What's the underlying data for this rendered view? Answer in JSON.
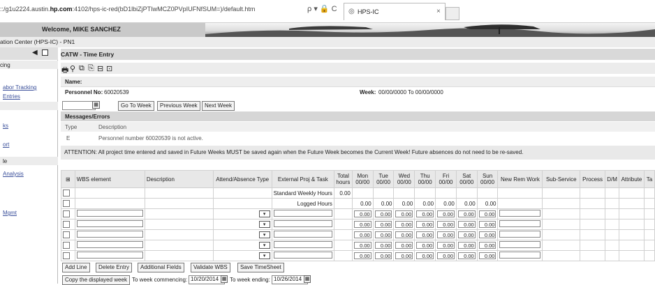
{
  "browser": {
    "url_prefix": "::/g1u2224.austin.",
    "url_host": "hp.com",
    "url_rest": ":4102/hps-ic-red(bD1lbiZjPTIwMCZ0PVpIUFNfSUM=)/default.htm",
    "url_icons": "ρ ▾ 🔒 C",
    "tab_title": "HPS-IC",
    "tab_close": "×"
  },
  "header": {
    "welcome": "Welcome, MIKE SANCHEZ",
    "org_title": "ation Center (HPS-IC) - PN1"
  },
  "nav": {
    "items": [
      {
        "label": "cing",
        "link": false
      },
      {
        "label": "abor Tracking",
        "link": true
      },
      {
        "label": "Entries",
        "link": true
      },
      {
        "label": "ks",
        "link": true
      },
      {
        "label": "ort",
        "link": true
      },
      {
        "label": "le",
        "link": false
      },
      {
        "label": "Analysis",
        "link": true
      },
      {
        "label": "Mgmt",
        "link": true
      }
    ]
  },
  "page": {
    "title": "CATW - Time Entry",
    "name_label": "Name:",
    "personnel_label": "Personnel No:",
    "personnel_value": "60020539",
    "week_label": "Week:",
    "week_value": "00/00/0000 To 00/00/0000",
    "goto_week": "Go To Week",
    "prev_week": "Previous Week",
    "next_week": "Next Week"
  },
  "messages": {
    "title": "Messages/Errors",
    "col_type": "Type",
    "col_desc": "Description",
    "rows": [
      {
        "type": "E",
        "desc": "Personnel number 60020539 is not active."
      }
    ]
  },
  "attention": "ATTENTION: All project time entered and saved in Future Weeks MUST be saved again when the Future Week becomes the Current Week! Future absences do not need to be re-saved.",
  "grid": {
    "headers": {
      "wbs": "WBS element",
      "description": "Description",
      "attend": "Attend/Absence Type",
      "ext": "External Proj & Task",
      "total": "Total hours",
      "mon": "Mon 00/00",
      "tue": "Tue 00/00",
      "wed": "Wed 00/00",
      "thu": "Thu 00/00",
      "fri": "Fri 00/00",
      "sat": "Sat 00/00",
      "sun": "Sun 00/00",
      "rem": "New Rem Work",
      "sub": "Sub-Service",
      "process": "Process",
      "dm": "D/M",
      "attribute": "Attribute",
      "ta": "Ta"
    },
    "standard_label": "Standard Weekly Hours",
    "standard_total": "0.00",
    "logged_label": "Logged Hours",
    "logged_values": [
      "0.00",
      "0.00",
      "0.00",
      "0.00",
      "0.00",
      "0.00",
      "0.00"
    ],
    "entry_value": "0.00",
    "dropdown_glyph": "▾"
  },
  "actions": {
    "add_line": "Add Line",
    "delete_entry": "Delete Entry",
    "additional_fields": "Additional Fields",
    "validate_wbs": "Validate WBS",
    "save": "Save TimeSheet",
    "copy": "Copy the displayed week",
    "to_week_commencing": "To week commencing:",
    "commencing_value": "10/20/2014",
    "to_week_ending": "To week ending:",
    "ending_value": "10/26/2014"
  }
}
